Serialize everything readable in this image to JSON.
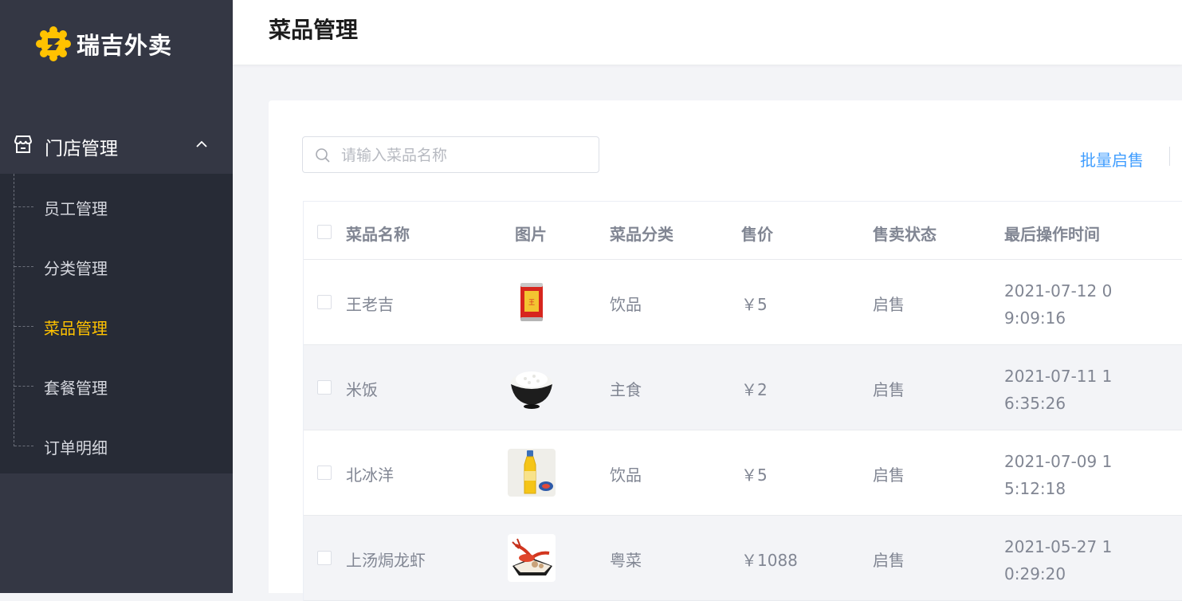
{
  "app": {
    "name": "瑞吉外卖"
  },
  "sidebar": {
    "group": {
      "label": "门店管理",
      "icon": "store-icon",
      "expanded": true
    },
    "items": [
      {
        "label": "员工管理",
        "active": false
      },
      {
        "label": "分类管理",
        "active": false
      },
      {
        "label": "菜品管理",
        "active": true
      },
      {
        "label": "套餐管理",
        "active": false
      },
      {
        "label": "订单明细",
        "active": false
      }
    ]
  },
  "header": {
    "title": "菜品管理"
  },
  "toolbar": {
    "search_placeholder": "请输入菜品名称",
    "search_value": "",
    "batch_enable_label": "批量启售"
  },
  "table": {
    "columns": [
      "菜品名称",
      "图片",
      "菜品分类",
      "售价",
      "售卖状态",
      "最后操作时间"
    ],
    "rows": [
      {
        "name": "王老吉",
        "image": "red-can-drink",
        "category": "饮品",
        "price": "￥5",
        "status": "启售",
        "updated": "2021-07-12 09:09:16"
      },
      {
        "name": "米饭",
        "image": "rice-bowl",
        "category": "主食",
        "price": "￥2",
        "status": "启售",
        "updated": "2021-07-11 16:35:26"
      },
      {
        "name": "北冰洋",
        "image": "orange-soda-bottle",
        "category": "饮品",
        "price": "￥5",
        "status": "启售",
        "updated": "2021-07-09 15:12:18"
      },
      {
        "name": "上汤焗龙虾",
        "image": "lobster-dish",
        "category": "粤菜",
        "price": "￥1088",
        "status": "启售",
        "updated": "2021-05-27 10:29:20"
      }
    ]
  },
  "colors": {
    "sidebar_bg": "#343744",
    "submenu_bg": "#272b36",
    "accent": "#ffc200",
    "link": "#419eff",
    "stripe": "#f3f4f7"
  }
}
